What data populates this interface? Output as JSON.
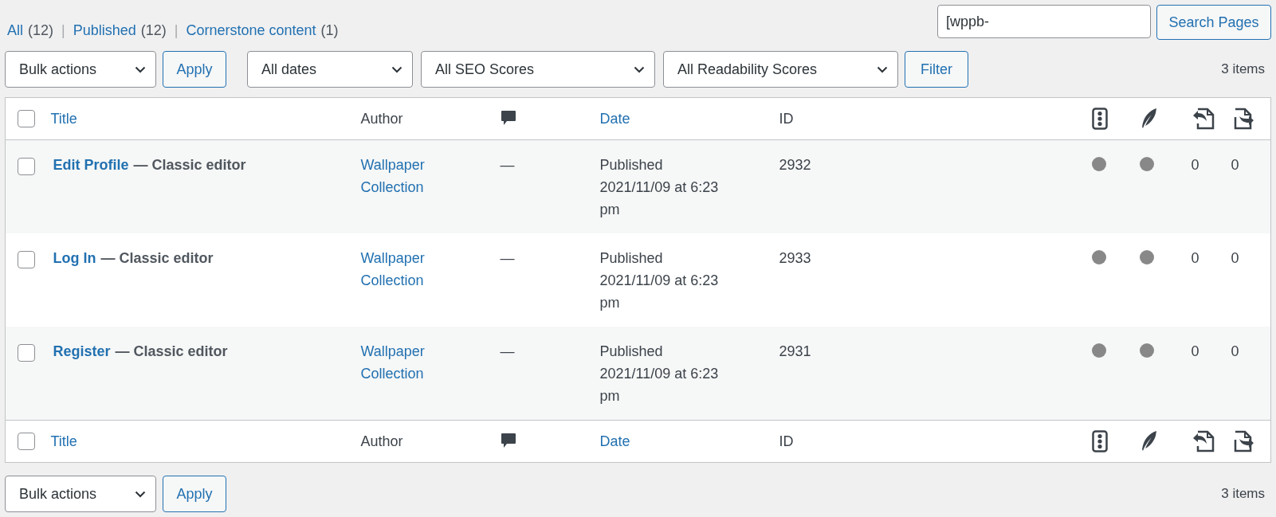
{
  "filters": [
    {
      "label": "All",
      "count": "(12)"
    },
    {
      "separator": "|",
      "label": "Published",
      "count": "(12)"
    },
    {
      "separator": "|",
      "label": "Cornerstone content",
      "count": "(1)"
    }
  ],
  "search": {
    "value": "[wppb-",
    "button": "Search Pages"
  },
  "top_actions": {
    "bulk": "Bulk actions",
    "apply": "Apply",
    "selects": [
      "All dates",
      "All SEO Scores",
      "All Readability Scores"
    ],
    "filter": "Filter",
    "count": "3 items"
  },
  "table": {
    "columns": [
      {
        "kind": "check",
        "checked": false
      },
      {
        "kind": "text",
        "label": "Title",
        "sortable": true
      },
      {
        "kind": "text",
        "label": "Author",
        "sortable": false
      },
      {
        "kind": "comments"
      },
      {
        "kind": "text",
        "label": "Date",
        "sortable": true
      },
      {
        "kind": "text",
        "label": "ID",
        "sortable": false
      },
      {
        "kind": "seo"
      },
      {
        "kind": "readability"
      },
      {
        "kind": "links-in"
      },
      {
        "kind": "links-out"
      }
    ],
    "rows": [
      {
        "checked": false,
        "title": "Edit Profile",
        "state": "— Classic editor",
        "author": "Wallpaper Collection",
        "comments": "—",
        "status": "Published",
        "date": "2021/11/09 at 6:23 pm",
        "id": "2932",
        "links_in": "0",
        "links_out": "0"
      },
      {
        "checked": false,
        "title": "Log In",
        "state": "— Classic editor",
        "author": "Wallpaper Collection",
        "comments": "—",
        "status": "Published",
        "date": "2021/11/09 at 6:23 pm",
        "id": "2933",
        "links_in": "0",
        "links_out": "0"
      },
      {
        "checked": false,
        "title": "Register",
        "state": "— Classic editor",
        "author": "Wallpaper Collection",
        "comments": "—",
        "status": "Published",
        "date": "2021/11/09 at 6:23 pm",
        "id": "2931",
        "links_in": "0",
        "links_out": "0"
      }
    ],
    "footer_columns": [
      {
        "kind": "check",
        "checked": false
      },
      {
        "kind": "text",
        "label": "Title",
        "sortable": true
      },
      {
        "kind": "text",
        "label": "Author",
        "sortable": false
      },
      {
        "kind": "comments"
      },
      {
        "kind": "text",
        "label": "Date",
        "sortable": true
      },
      {
        "kind": "text",
        "label": "ID",
        "sortable": false
      },
      {
        "kind": "seo"
      },
      {
        "kind": "readability"
      },
      {
        "kind": "links-in"
      },
      {
        "kind": "links-out"
      }
    ]
  },
  "bottom_actions": {
    "bulk": "Bulk actions",
    "apply": "Apply",
    "count": "3 items"
  }
}
